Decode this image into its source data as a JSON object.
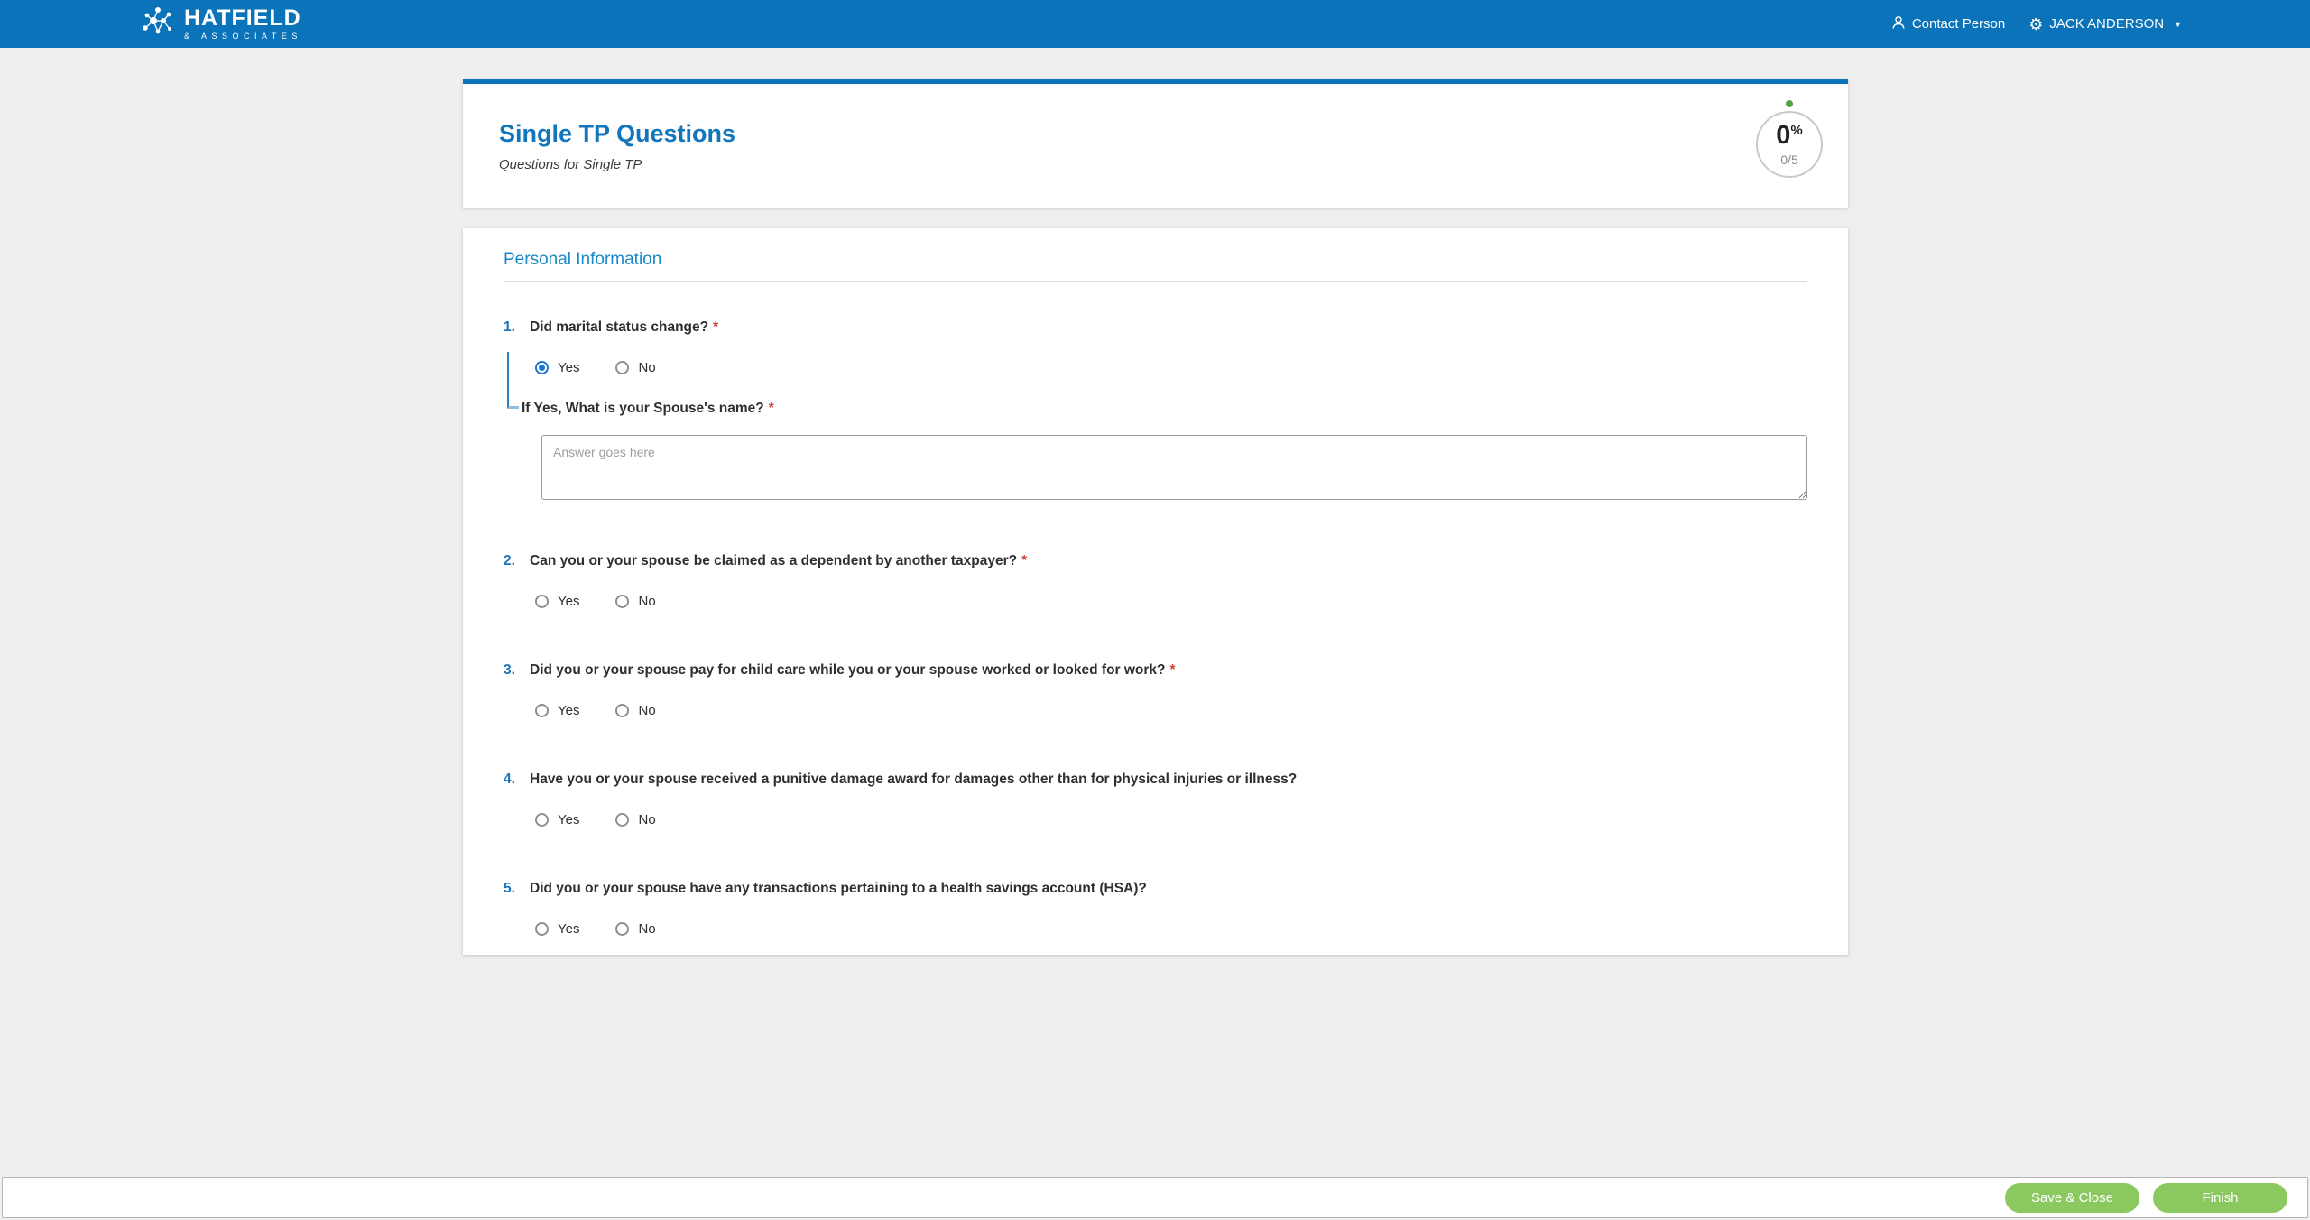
{
  "header": {
    "brand": {
      "name": "HATFIELD",
      "subname": "& ASSOCIATES"
    },
    "contact_label": "Contact Person",
    "user_name": "JACK ANDERSON"
  },
  "form": {
    "title": "Single TP Questions",
    "subtitle": "Questions for Single TP",
    "progress": {
      "percent": "0",
      "percent_symbol": "%",
      "fraction": "0/5"
    },
    "section": {
      "title": "Personal Information",
      "questions": [
        {
          "number": "1.",
          "text": "Did marital status change?",
          "required_mark": "*",
          "options": [
            "Yes",
            "No"
          ],
          "selected": "Yes",
          "sub": {
            "text": "If Yes, What is your Spouse's name?",
            "required_mark": "*",
            "placeholder": "Answer goes here",
            "value": ""
          }
        },
        {
          "number": "2.",
          "text": "Can you or your spouse be claimed as a dependent by another taxpayer?",
          "required_mark": "*",
          "options": [
            "Yes",
            "No"
          ],
          "selected": ""
        },
        {
          "number": "3.",
          "text": "Did you or your spouse pay for child care while you or your spouse worked or looked for work?",
          "required_mark": "*",
          "options": [
            "Yes",
            "No"
          ],
          "selected": ""
        },
        {
          "number": "4.",
          "text": "Have you or your spouse received a punitive damage award for damages other than for physical injuries or illness?",
          "required_mark": "",
          "options": [
            "Yes",
            "No"
          ],
          "selected": ""
        },
        {
          "number": "5.",
          "text": "Did you or your spouse have any transactions pertaining to a health savings account (HSA)?",
          "required_mark": "",
          "options": [
            "Yes",
            "No"
          ],
          "selected": ""
        }
      ]
    }
  },
  "footer": {
    "save_label": "Save & Close",
    "finish_label": "Finish"
  },
  "colors": {
    "topbar_blue": "#0b73ba",
    "title_blue": "#1176bb",
    "section_blue": "#1989c8",
    "radio_selected_blue": "#1976d2",
    "required_red": "#cf4436",
    "button_green": "#8bc85f",
    "progress_dot_green": "#56a046",
    "page_background": "#efefef"
  }
}
